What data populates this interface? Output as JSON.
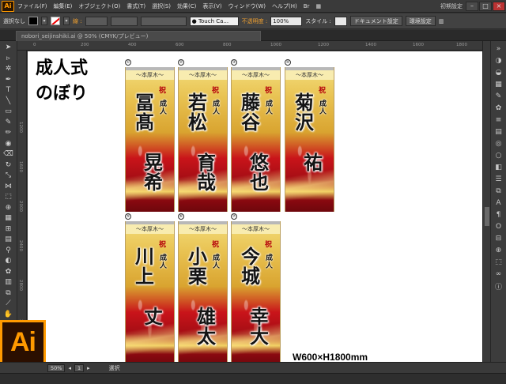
{
  "menubar": {
    "logo": "Ai",
    "items": [
      "ファイル(F)",
      "編集(E)",
      "オブジェクト(O)",
      "書式(T)",
      "選択(S)",
      "効果(C)",
      "表示(V)",
      "ウィンドウ(W)",
      "ヘルプ(H)"
    ],
    "workspace": "初期設定",
    "minimize": "–",
    "maximize": "□",
    "close": "×"
  },
  "controlbar": {
    "selection": "選択なし",
    "stroke_label": "線 :",
    "brush": "Touch Ca...",
    "opacity_label": "不透明度 :",
    "opacity_value": "100%",
    "style_label": "スタイル :",
    "doc_settings": "ドキュメント設定",
    "env_settings": "環境設定"
  },
  "tab": {
    "title": "nobori_seijinshiki.ai @ 50% (CMYK/プレビュー)"
  },
  "ruler": {
    "top_marks": [
      "0",
      "200",
      "400",
      "600",
      "800",
      "1000",
      "1200",
      "1400",
      "1600",
      "1800"
    ],
    "left_marks": [
      "1200",
      "1600",
      "2000",
      "2400",
      "2800",
      "3200"
    ]
  },
  "canvas": {
    "title_line1": "成人式",
    "title_line2": "のぼり",
    "size_label": "W600×H1800mm"
  },
  "banners": [
    {
      "num": "①",
      "header": "～本厚木～",
      "shuku": "祝",
      "seijin": "成人",
      "col1": "冨髙",
      "col2": "晃希"
    },
    {
      "num": "②",
      "header": "～本厚木～",
      "shuku": "祝",
      "seijin": "成人",
      "col1": "若松",
      "col2": "育哉"
    },
    {
      "num": "③",
      "header": "～本厚木～",
      "shuku": "祝",
      "seijin": "成人",
      "col1": "藤谷",
      "col2": "悠也"
    },
    {
      "num": "④",
      "header": "～本厚木～",
      "shuku": "祝",
      "seijin": "成人",
      "col1": "菊沢",
      "col2": "祐"
    },
    {
      "num": "⑤",
      "header": "～本厚木～",
      "shuku": "祝",
      "seijin": "成人",
      "col1": "川上",
      "col2": "丈"
    },
    {
      "num": "⑥",
      "header": "～本厚木～",
      "shuku": "祝",
      "seijin": "成人",
      "col1": "小栗",
      "col2": "雄太"
    },
    {
      "num": "⑦",
      "header": "～本厚木～",
      "shuku": "祝",
      "seijin": "成人",
      "col1": "今城",
      "col2": "幸大"
    }
  ],
  "statusbar": {
    "zoom": "50%",
    "page": "1",
    "mode": "選択"
  },
  "ai_logo": "Ai",
  "colors": {
    "accent": "#ff9a00",
    "banner_gold": "#e8c150",
    "banner_red": "#c9141a"
  }
}
